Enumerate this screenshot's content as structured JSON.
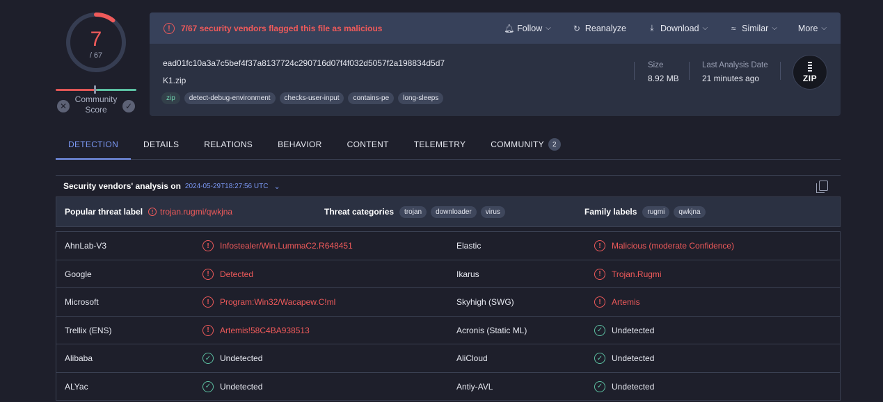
{
  "score": {
    "detected": "7",
    "total": "/ 67",
    "fraction": 0.1045,
    "community_label": "Community\nScore"
  },
  "header": {
    "alert": "7/67 security vendors flagged this file as malicious",
    "actions": [
      {
        "label": "Follow",
        "icon": "bell-icon",
        "dropdown": true
      },
      {
        "label": "Reanalyze",
        "icon": "refresh-icon",
        "dropdown": false
      },
      {
        "label": "Download",
        "icon": "download-icon",
        "dropdown": true
      },
      {
        "label": "Similar",
        "icon": "similar-icon",
        "dropdown": true
      },
      {
        "label": "More",
        "icon": "",
        "dropdown": true
      }
    ],
    "hash": "ead01fc10a3a7c5bef4f37a8137724c290716d07f4f032d5057f2a198834d5d7",
    "filename": "K1.zip",
    "tags": [
      "zip",
      "detect-debug-environment",
      "checks-user-input",
      "contains-pe",
      "long-sleeps"
    ],
    "size_label": "Size",
    "size_value": "8.92 MB",
    "date_label": "Last Analysis Date",
    "date_value": "21 minutes ago",
    "file_type": "ZIP"
  },
  "tabs": [
    {
      "label": "DETECTION",
      "active": true
    },
    {
      "label": "DETAILS"
    },
    {
      "label": "RELATIONS"
    },
    {
      "label": "BEHAVIOR"
    },
    {
      "label": "CONTENT"
    },
    {
      "label": "TELEMETRY"
    },
    {
      "label": "COMMUNITY",
      "badge": "2"
    }
  ],
  "analysis": {
    "title": "Security vendors' analysis on",
    "date": "2024-05-29T18:27:56 UTC"
  },
  "threat": {
    "popular_label": "Popular threat label",
    "popular_value": "trojan.rugmi/qwkjna",
    "categories_label": "Threat categories",
    "categories": [
      "trojan",
      "downloader",
      "virus"
    ],
    "family_label": "Family labels",
    "families": [
      "rugmi",
      "qwkjna"
    ]
  },
  "results": [
    {
      "v1": "AhnLab-V3",
      "r1": "Infostealer/Win.LummaC2.R648451",
      "s1": "bad",
      "v2": "Elastic",
      "r2": "Malicious (moderate Confidence)",
      "s2": "bad"
    },
    {
      "v1": "Google",
      "r1": "Detected",
      "s1": "bad",
      "v2": "Ikarus",
      "r2": "Trojan.Rugmi",
      "s2": "bad"
    },
    {
      "v1": "Microsoft",
      "r1": "Program:Win32/Wacapew.C!ml",
      "s1": "bad",
      "v2": "Skyhigh (SWG)",
      "r2": "Artemis",
      "s2": "bad"
    },
    {
      "v1": "Trellix (ENS)",
      "r1": "Artemis!58C4BA938513",
      "s1": "bad",
      "v2": "Acronis (Static ML)",
      "r2": "Undetected",
      "s2": "good"
    },
    {
      "v1": "Alibaba",
      "r1": "Undetected",
      "s1": "good",
      "v2": "AliCloud",
      "r2": "Undetected",
      "s2": "good"
    },
    {
      "v1": "ALYac",
      "r1": "Undetected",
      "s1": "good",
      "v2": "Antiy-AVL",
      "r2": "Undetected",
      "s2": "good"
    }
  ],
  "colors": {
    "malicious": "#ef5a5a",
    "clean": "#5cc0a2",
    "accent": "#7a97f2"
  }
}
